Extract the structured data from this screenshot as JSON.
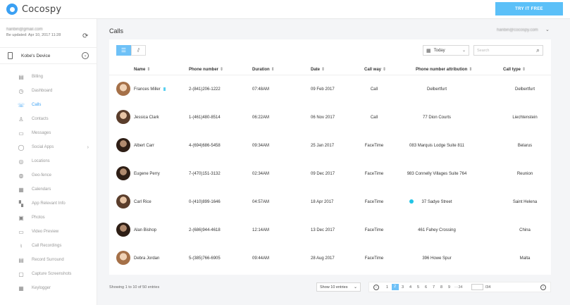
{
  "app": {
    "name": "Cocospy",
    "try_label": "TRY IT FREE"
  },
  "account": {
    "email": "hanbin@gmail.com",
    "updated": "Be updated: Apr 10, 2017 11:28"
  },
  "device": {
    "name": "Kobe's Device"
  },
  "menu": [
    {
      "label": "Billing",
      "icon": "billing-icon",
      "glyph": "▤"
    },
    {
      "label": "Dashboard",
      "icon": "dashboard-icon",
      "glyph": "◷"
    },
    {
      "label": "Calls",
      "icon": "phone-icon",
      "glyph": "☏"
    },
    {
      "label": "Contacts",
      "icon": "contacts-icon",
      "glyph": "♙"
    },
    {
      "label": "Messages",
      "icon": "messages-icon",
      "glyph": "▭"
    },
    {
      "label": "Social Apps",
      "icon": "social-apps-icon",
      "glyph": "◯"
    },
    {
      "label": "Locations",
      "icon": "location-icon",
      "glyph": "◎"
    },
    {
      "label": "Geo-fence",
      "icon": "geofence-icon",
      "glyph": "◍"
    },
    {
      "label": "Calendars",
      "icon": "calendar-icon",
      "glyph": "▦"
    },
    {
      "label": "App Relevant Info",
      "icon": "apps-grid-icon",
      "glyph": "▚"
    },
    {
      "label": "Photos",
      "icon": "photo-icon",
      "glyph": "▣"
    },
    {
      "label": "Video Preview",
      "icon": "video-icon",
      "glyph": "▭"
    },
    {
      "label": "Call Recordings",
      "icon": "microphone-icon",
      "glyph": "♮"
    },
    {
      "label": "Record Surround",
      "icon": "record-icon",
      "glyph": "▤"
    },
    {
      "label": "Capture Screenshots",
      "icon": "screenshot-icon",
      "glyph": "▢"
    },
    {
      "label": "Keylogger",
      "icon": "keyboard-icon",
      "glyph": "▦"
    }
  ],
  "main": {
    "title": "Calls",
    "user": "hanbin@cocospy.com",
    "date_filter": "Today",
    "search_placeholder": "Search"
  },
  "table": {
    "headers": [
      "Name",
      "Phone number",
      "Duration",
      "Date",
      "Call way",
      "Phone number attribution",
      "Call type"
    ],
    "rows": [
      {
        "name": "Frances Miller",
        "phone": "2-(841)206-1222",
        "duration": "07:48AM",
        "date": "09 Feb 2017",
        "way": "Call",
        "attribution": "Delbertfurt",
        "type": "Delbertfurt",
        "badge": true,
        "dot": false
      },
      {
        "name": "Jessica Clark",
        "phone": "1-(461)480-8514",
        "duration": "06:22AM",
        "date": "06 Nov 2017",
        "way": "Call",
        "attribution": "77 Dion Courts",
        "type": "Liechtenstein",
        "badge": false,
        "dot": false
      },
      {
        "name": "Albert Carr",
        "phone": "4-(694)686-5458",
        "duration": "09:34AM",
        "date": "25 Jan 2017",
        "way": "FaceTime",
        "attribution": "083 Marquis Lodge Suite 811",
        "type": "Belarus",
        "badge": false,
        "dot": false
      },
      {
        "name": "Eugene Perry",
        "phone": "7-(470)151-3132",
        "duration": "02:34AM",
        "date": "09 Dec 2017",
        "way": "FaceTime",
        "attribution": "983 Connelly Villages Suite 764",
        "type": "Reunion",
        "badge": false,
        "dot": false
      },
      {
        "name": "Carl Rice",
        "phone": "0-(410)899-1646",
        "duration": "04:57AM",
        "date": "18 Apr 2017",
        "way": "FaceTime",
        "attribution": "37 Sadye Street",
        "type": "Saint Helena",
        "badge": false,
        "dot": true
      },
      {
        "name": "Alan Bishop",
        "phone": "2-(686)944-4618",
        "duration": "12:14AM",
        "date": "13 Dec 2017",
        "way": "FaceTime",
        "attribution": "461 Fahey Crossing",
        "type": "China",
        "badge": false,
        "dot": false
      },
      {
        "name": "Debra Jordan",
        "phone": "5-(385)766-6905",
        "duration": "09:44AM",
        "date": "28 Aug 2017",
        "way": "FaceTime",
        "attribution": "396 Howe Spur",
        "type": "Malta",
        "badge": false,
        "dot": false
      }
    ]
  },
  "footer": {
    "showing": "Showing 1 to 10 of 50 entries",
    "per_page": "Show 10 entries",
    "pages": [
      "1",
      "2",
      "3",
      "4",
      "5",
      "6",
      "7",
      "8",
      "9"
    ],
    "current_page": "2",
    "ellipsis": "···34",
    "total": "/34"
  },
  "colors": {
    "accent": "#3aa0f3",
    "try_button": "#5bc0f8",
    "dot": "#22c4e6"
  }
}
